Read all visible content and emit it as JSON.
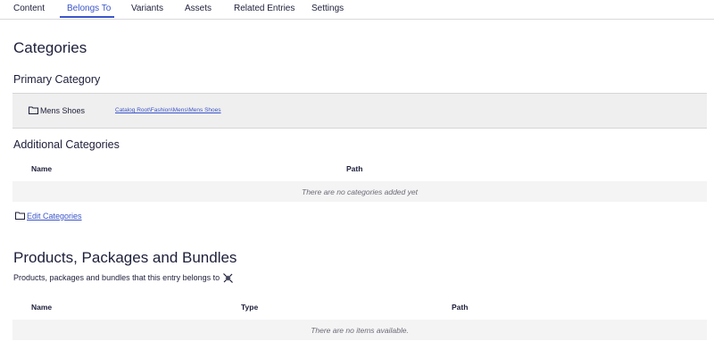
{
  "tabs": [
    {
      "label": "Content"
    },
    {
      "label": "Belongs To"
    },
    {
      "label": "Variants"
    },
    {
      "label": "Assets"
    },
    {
      "label": "Related Entries"
    },
    {
      "label": "Settings"
    }
  ],
  "active_tab": "Belongs To",
  "categories": {
    "title": "Categories",
    "primary": {
      "heading": "Primary Category",
      "name": "Mens Shoes",
      "path": "Catalog Root\\Fashion\\Mens\\Mens Shoes",
      "icon": "folder-icon"
    },
    "additional": {
      "heading": "Additional Categories",
      "columns": [
        "Name",
        "Path"
      ],
      "empty_text": "There are no categories added yet"
    },
    "edit_label": "Edit Categories"
  },
  "products": {
    "title": "Products, Packages and Bundles",
    "description": "Products, packages and bundles that this entry belongs to",
    "columns": [
      "Name",
      "Type",
      "Path"
    ],
    "empty_text": "There are no items available.",
    "icon": "unlink-icon"
  },
  "colors": {
    "accent": "#3b55c9",
    "text": "#1d1f3a",
    "muted_bg": "#efefef"
  }
}
